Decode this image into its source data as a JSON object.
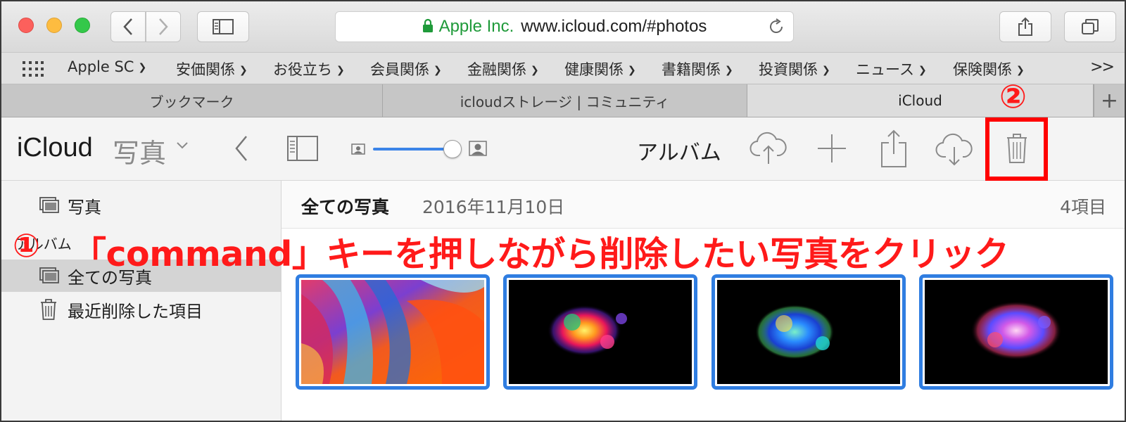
{
  "window": {
    "address_company": "Apple Inc.",
    "address_url": "www.icloud.com/#photos"
  },
  "bookmarks": [
    {
      "label": "Apple SC"
    },
    {
      "label": "安価関係"
    },
    {
      "label": "お役立ち"
    },
    {
      "label": "会員関係"
    },
    {
      "label": "金融関係"
    },
    {
      "label": "健康関係"
    },
    {
      "label": "書籍関係"
    },
    {
      "label": "投資関係"
    },
    {
      "label": "ニュース"
    },
    {
      "label": "保険関係"
    }
  ],
  "bookmarks_more": ">>",
  "tabs": [
    {
      "label": "ブックマーク",
      "active": false
    },
    {
      "label": "icloudストレージ | コミュニティ",
      "active": false
    },
    {
      "label": "iCloud",
      "active": true
    }
  ],
  "tab_new": "+",
  "header": {
    "brand": "iCloud",
    "app_name": "写真",
    "view_label": "アルバム"
  },
  "sidebar": {
    "items": [
      {
        "label": "写真"
      },
      {
        "label": "全ての写真"
      },
      {
        "label": "最近削除した項目"
      }
    ],
    "section_label": "アルバム"
  },
  "content": {
    "title": "全ての写真",
    "date": "2016年11月10日",
    "count": "4項目"
  },
  "annotations": {
    "step1_marker": "①",
    "instruction": "「command」キーを押しながら削除したい写真をクリック",
    "step2_marker": "②",
    "color": "#ff1a1a"
  },
  "colors": {
    "selection_blue": "#2f7de1",
    "address_company_green": "#1f9a3a"
  }
}
